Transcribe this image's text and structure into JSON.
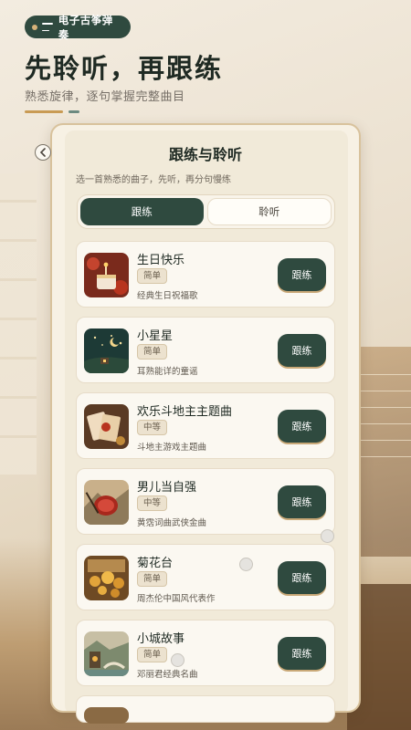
{
  "header": {
    "pill_label": "电子古筝弹奏",
    "headline": "先聆听，再跟练",
    "subline": "熟悉旋律，逐句掌握完整曲目"
  },
  "card": {
    "back_icon": "chevron-left-icon",
    "title": "跟练与聆听",
    "description": "选一首熟悉的曲子，先听，再分句慢练",
    "tabs": [
      {
        "label": "跟练",
        "active": true
      },
      {
        "label": "聆听",
        "active": false
      }
    ]
  },
  "songs": [
    {
      "title": "生日快乐",
      "level": "简单",
      "desc": "经典生日祝福歌",
      "action": "跟练"
    },
    {
      "title": "小星星",
      "level": "简单",
      "desc": "耳熟能详的童谣",
      "action": "跟练"
    },
    {
      "title": "欢乐斗地主主题曲",
      "level": "中等",
      "desc": "斗地主游戏主题曲",
      "action": "跟练"
    },
    {
      "title": "男儿当自强",
      "level": "中等",
      "desc": "黄霑词曲武侠金曲",
      "action": "跟练"
    },
    {
      "title": "菊花台",
      "level": "简单",
      "desc": "周杰伦中国风代表作",
      "action": "跟练"
    },
    {
      "title": "小城故事",
      "level": "简单",
      "desc": "邓丽君经典名曲",
      "action": "跟练"
    }
  ],
  "colors": {
    "primary_green": "#2f4a3f",
    "accent_gold": "#c99b54",
    "card_bg": "#f7f1e4"
  }
}
